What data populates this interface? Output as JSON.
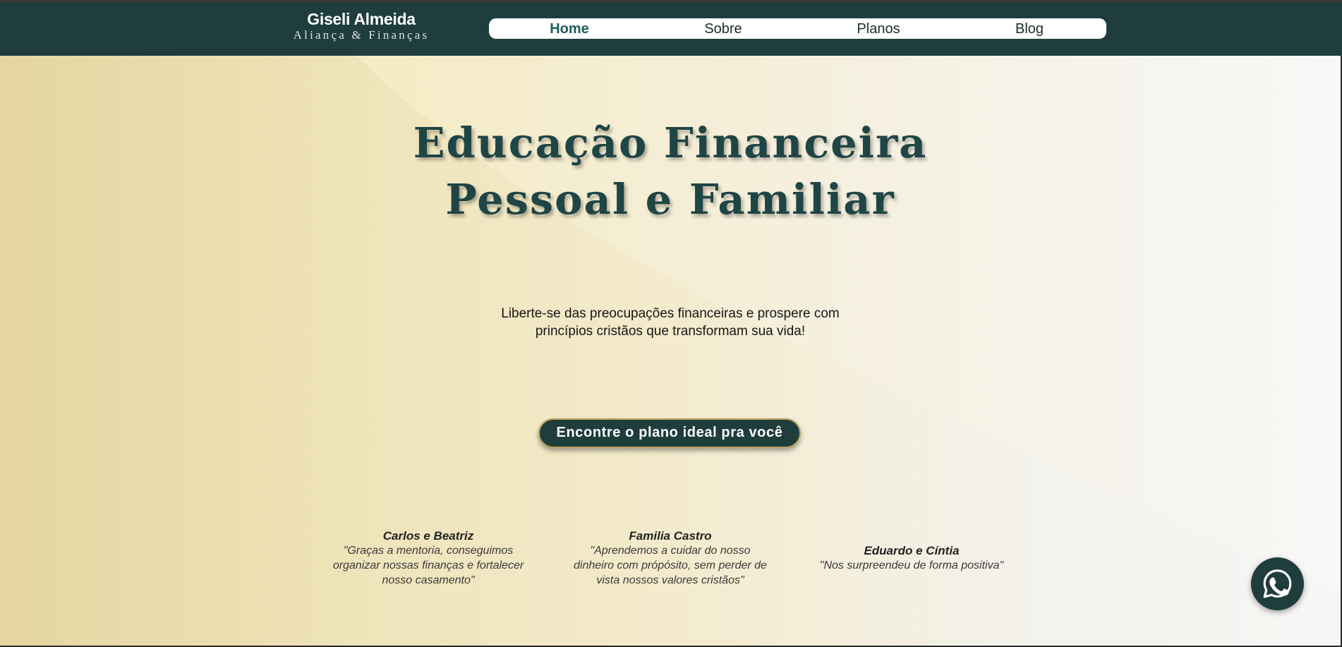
{
  "brand": {
    "name": "Giseli Almeida",
    "tagline": "Aliança & Finanças"
  },
  "nav": {
    "items": [
      {
        "label": "Home",
        "active": true
      },
      {
        "label": "Sobre",
        "active": false
      },
      {
        "label": "Planos",
        "active": false
      },
      {
        "label": "Blog",
        "active": false
      }
    ]
  },
  "hero": {
    "title_line1": "Educação Financeira",
    "title_line2": "Pessoal e Familiar",
    "subtitle_line1": "Liberte-se das preocupações financeiras e prospere com",
    "subtitle_line2": "princípios cristãos que transformam sua vida!",
    "cta_label": "Encontre o plano ideal pra você"
  },
  "testimonials": [
    {
      "name": "Carlos e Beatriz",
      "lines": [
        "\"Graças a mentoria, conseguimos",
        "organizar nossas finanças e fortalecer",
        "nosso casamento\""
      ]
    },
    {
      "name": "Familia Castro",
      "lines": [
        "\"Aprendemos a cuidar do nosso",
        "dinheiro com própósito, sem perder de",
        "vista nossos valores cristãos\""
      ]
    },
    {
      "name": "Eduardo e Cíntia",
      "lines": [
        "\"Nos surpreendeu de forma positiva\""
      ]
    }
  ],
  "floating": {
    "icon": "whatsapp-icon"
  },
  "colors": {
    "primary": "#1f3d3d",
    "accent_gold": "#b9a35f",
    "nav_active": "#1f5a5c",
    "hero_gold": "#e5d6a0"
  }
}
